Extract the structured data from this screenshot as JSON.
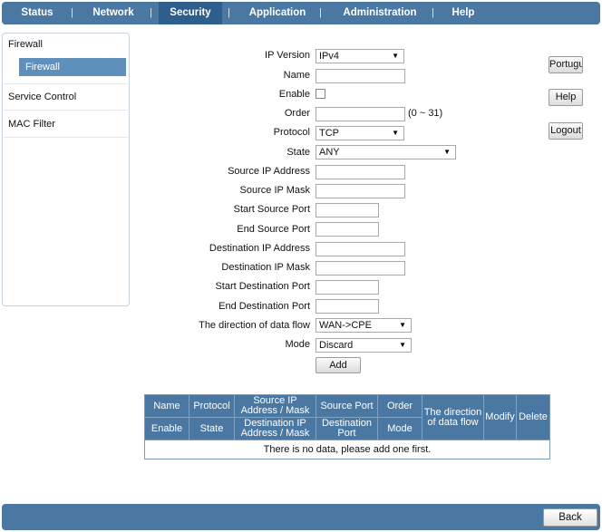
{
  "nav": {
    "tabs": [
      {
        "label": "Status"
      },
      {
        "label": "Network"
      },
      {
        "label": "Security",
        "active": true
      },
      {
        "label": "Application"
      },
      {
        "label": "Administration"
      },
      {
        "label": "Help"
      }
    ],
    "separator": "|"
  },
  "sidebar": {
    "items": [
      {
        "label": "Firewall"
      },
      {
        "label": "Firewall",
        "sub": true,
        "selected": true
      },
      {
        "label": "Service Control"
      },
      {
        "label": "MAC Filter"
      }
    ]
  },
  "form": {
    "ip_version": {
      "label": "IP Version",
      "value": "IPv4"
    },
    "name": {
      "label": "Name",
      "value": ""
    },
    "enable": {
      "label": "Enable",
      "checked": false
    },
    "order": {
      "label": "Order",
      "value": "",
      "hint": "(0 ~ 31)"
    },
    "protocol": {
      "label": "Protocol",
      "value": "TCP"
    },
    "state": {
      "label": "State",
      "value": "ANY"
    },
    "source_ip": {
      "label": "Source IP Address",
      "value": ""
    },
    "source_mask": {
      "label": "Source IP Mask",
      "value": ""
    },
    "start_source_port": {
      "label": "Start Source Port",
      "value": ""
    },
    "end_source_port": {
      "label": "End Source Port",
      "value": ""
    },
    "dest_ip": {
      "label": "Destination IP Address",
      "value": ""
    },
    "dest_mask": {
      "label": "Destination IP Mask",
      "value": ""
    },
    "start_dest_port": {
      "label": "Start Destination Port",
      "value": ""
    },
    "end_dest_port": {
      "label": "End Destination Port",
      "value": ""
    },
    "direction": {
      "label": "The direction of data flow",
      "value": "WAN->CPE"
    },
    "mode": {
      "label": "Mode",
      "value": "Discard"
    },
    "add_label": "Add"
  },
  "right_buttons": {
    "language": "Portugu",
    "help": "Help",
    "logout": "Logout"
  },
  "table": {
    "headers": {
      "name": "Name",
      "protocol": "Protocol",
      "source_ip_mask": "Source IP Address / Mask",
      "source_port": "Source Port",
      "order": "Order",
      "direction": "The direction of data flow",
      "modify": "Modify",
      "delete": "Delete",
      "enable": "Enable",
      "state": "State",
      "dest_ip_mask": "Destination IP Address / Mask",
      "dest_port": "Destination Port",
      "mode": "Mode"
    },
    "empty_message": "There is no data, please add one first."
  },
  "footer": {
    "back_label": "Back"
  },
  "colors": {
    "nav_bg": "#4a78a3",
    "nav_active": "#2d5e8c",
    "sidebar_selected": "#5f8fbb"
  }
}
